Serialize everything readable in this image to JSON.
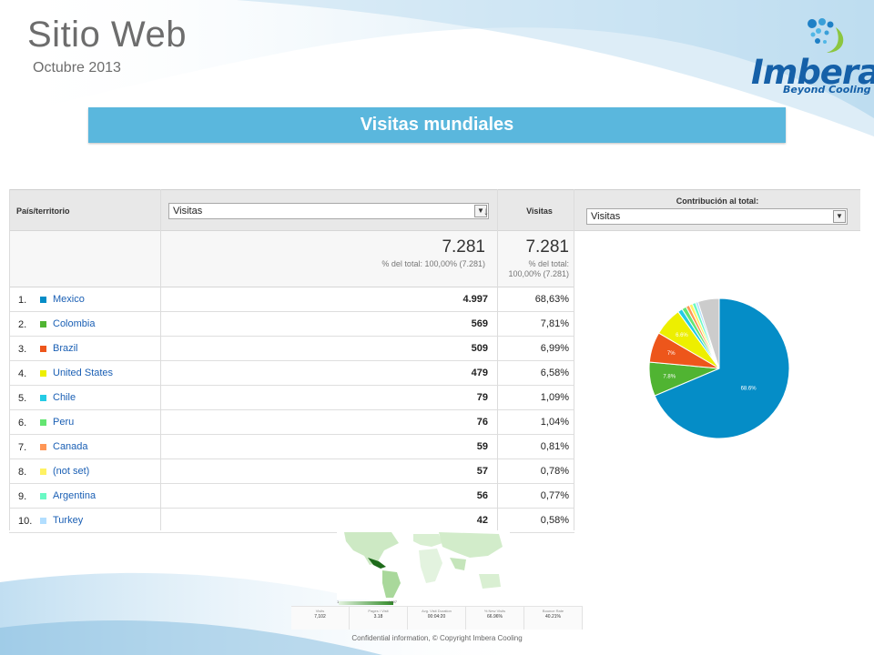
{
  "slide": {
    "title": "Sitio Web",
    "subtitle": "Octubre 2013",
    "section_title": "Visitas mundiales",
    "footer": "Confidential information, © Copyright Imbera Cooling"
  },
  "logo": {
    "word": "Imbera",
    "registered": "®",
    "tagline": "Beyond Cooling",
    "icon": "imbera-dots-logo-icon"
  },
  "analytics": {
    "header": {
      "dimension": "País/territorio",
      "metric_select": "Visitas",
      "visits": "Visitas",
      "contribution": "Contribución al total:",
      "contribution_select": "Visitas"
    },
    "summary": {
      "metric_total": "7.281",
      "metric_note": "% del total: 100,00% (7.281)",
      "visits_total": "7.281",
      "visits_note_1": "% del total:",
      "visits_note_2": "100,00% (7.281)"
    },
    "rows": [
      {
        "index": "1.",
        "country": "Mexico",
        "visits": "4.997",
        "percent": "68,63%",
        "color": "#058dc7"
      },
      {
        "index": "2.",
        "country": "Colombia",
        "visits": "569",
        "percent": "7,81%",
        "color": "#50b432"
      },
      {
        "index": "3.",
        "country": "Brazil",
        "visits": "509",
        "percent": "6,99%",
        "color": "#ed561b"
      },
      {
        "index": "4.",
        "country": "United States",
        "visits": "479",
        "percent": "6,58%",
        "color": "#edef00"
      },
      {
        "index": "5.",
        "country": "Chile",
        "visits": "79",
        "percent": "1,09%",
        "color": "#24cbe5"
      },
      {
        "index": "6.",
        "country": "Peru",
        "visits": "76",
        "percent": "1,04%",
        "color": "#64e572"
      },
      {
        "index": "7.",
        "country": "Canada",
        "visits": "59",
        "percent": "0,81%",
        "color": "#ff9655"
      },
      {
        "index": "8.",
        "country": "(not set)",
        "visits": "57",
        "percent": "0,78%",
        "color": "#fff263"
      },
      {
        "index": "9.",
        "country": "Argentina",
        "visits": "56",
        "percent": "0,77%",
        "color": "#6af9c4"
      },
      {
        "index": "10.",
        "country": "Turkey",
        "visits": "42",
        "percent": "0,58%",
        "color": "#b2deff"
      }
    ]
  },
  "chart_data": {
    "type": "pie",
    "slices": [
      {
        "label": "Mexico",
        "value": 68.63,
        "color": "#058dc7",
        "data_label": "68.6%"
      },
      {
        "label": "Colombia",
        "value": 7.81,
        "color": "#50b432",
        "data_label": "7.8%"
      },
      {
        "label": "Brazil",
        "value": 6.99,
        "color": "#ed561b",
        "data_label": "7%"
      },
      {
        "label": "United States",
        "value": 6.58,
        "color": "#edef00",
        "data_label": "6.6%"
      },
      {
        "label": "Chile",
        "value": 1.09,
        "color": "#24cbe5",
        "data_label": ""
      },
      {
        "label": "Peru",
        "value": 1.04,
        "color": "#64e572",
        "data_label": ""
      },
      {
        "label": "Canada",
        "value": 0.81,
        "color": "#ff9655",
        "data_label": ""
      },
      {
        "label": "(not set)",
        "value": 0.78,
        "color": "#fff263",
        "data_label": ""
      },
      {
        "label": "Argentina",
        "value": 0.77,
        "color": "#6af9c4",
        "data_label": ""
      },
      {
        "label": "Turkey",
        "value": 0.58,
        "color": "#b2deff",
        "data_label": ""
      },
      {
        "label": "",
        "value": 4.92,
        "color": "#cccccc",
        "data_label": ""
      }
    ]
  },
  "map_summary": {
    "scale_min": "1",
    "scale_max": "4,997",
    "metrics": [
      {
        "label": "Visits",
        "value": "7,102"
      },
      {
        "label": "Pages / Visit",
        "value": "3.18"
      },
      {
        "label": "Avg. Visit Duration",
        "value": "00:04:20"
      },
      {
        "label": "% New Visits",
        "value": "66.96%"
      },
      {
        "label": "Bounce Rate",
        "value": "40.21%"
      }
    ]
  }
}
